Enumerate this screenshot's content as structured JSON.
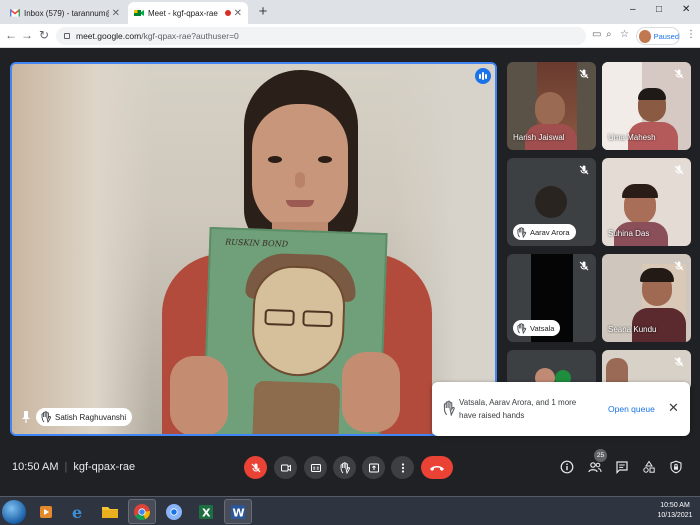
{
  "browser": {
    "tabs": [
      {
        "title": "Inbox (579) - tarannum@theindi",
        "active": false
      },
      {
        "title": "Meet - kgf-qpax-rae",
        "active": true
      }
    ],
    "new_tab_label": "+",
    "url_host": "meet.google.com",
    "url_path": "/kgf-qpax-rae?authuser=0",
    "profile_label": "Paused",
    "window_controls": [
      "–",
      "□",
      "✕"
    ]
  },
  "meeting": {
    "time": "10:50 AM",
    "code": "kgf-qpax-rae",
    "people_count": "25",
    "presenter": {
      "name": "Satish Raghuvanshi"
    },
    "drawing_caption": "RUSKIN BOND",
    "participants": [
      {
        "name": "Harish Jaiswal",
        "muted": true,
        "hand_raised": false
      },
      {
        "name": "Uma Mahesh",
        "muted": true,
        "hand_raised": false
      },
      {
        "name": "Aarav Arora",
        "muted": true,
        "hand_raised": true
      },
      {
        "name": "Suhina Das",
        "muted": true,
        "hand_raised": false
      },
      {
        "name": "Vatsala",
        "muted": true,
        "hand_raised": true
      },
      {
        "name": "Seana Kundu",
        "muted": true,
        "hand_raised": false
      }
    ]
  },
  "toast": {
    "message": "Vatsala, Aarav Arora, and 1 more have raised hands",
    "action": "Open queue",
    "close": "✕"
  },
  "taskbar": {
    "time": "10:50 AM",
    "date": "10/13/2021",
    "apps": [
      "windows-explorer",
      "media-player",
      "internet-explorer",
      "file-explorer",
      "chrome",
      "chrome-canary",
      "excel",
      "word"
    ]
  },
  "colors": {
    "meet_bg": "#202124",
    "accent_blue": "#1a73e8",
    "danger_red": "#ea4335",
    "active_border": "#4285f4"
  }
}
